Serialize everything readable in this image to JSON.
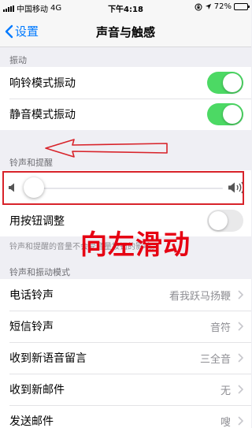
{
  "status_bar": {
    "carrier": "中国移动",
    "network": "4G",
    "time": "下午4:18",
    "battery": "72%"
  },
  "nav": {
    "back_label": "设置",
    "title": "声音与触感"
  },
  "vibration": {
    "header": "振动",
    "items": [
      {
        "label": "响铃模式振动",
        "toggle": "on"
      },
      {
        "label": "静音模式振动",
        "toggle": "on"
      }
    ]
  },
  "ringer": {
    "header": "铃声和提醒",
    "volume_level": 0.0,
    "buttons_label": "用按钮调整",
    "buttons_toggle": "off",
    "footnote": "铃声和提醒的音量不会受音量按钮的影响。"
  },
  "patterns": {
    "header": "铃声和振动模式",
    "items": [
      {
        "label": "电话铃声",
        "value": "看我跃马扬鞭"
      },
      {
        "label": "短信铃声",
        "value": "音符"
      },
      {
        "label": "收到新语音留言",
        "value": "三全音"
      },
      {
        "label": "收到新邮件",
        "value": "无"
      },
      {
        "label": "发送邮件",
        "value": "嗖"
      }
    ]
  },
  "annotation": {
    "text": "向左滑动"
  },
  "colors": {
    "accent": "#007aff",
    "toggle_on": "#4cd964",
    "annotation_red": "#e60012"
  }
}
